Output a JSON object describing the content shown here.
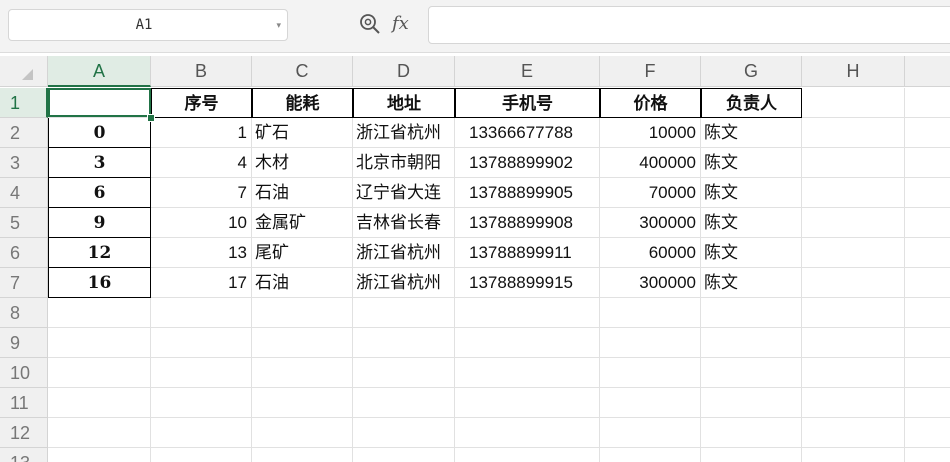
{
  "formula_bar": {
    "name_box_value": "A1",
    "name_box_dropdown": "▾",
    "zoom_icon": "zoom-formula-icon",
    "fx_label": "fx",
    "formula_value": ""
  },
  "columns": [
    "A",
    "B",
    "C",
    "D",
    "E",
    "F",
    "G",
    "H"
  ],
  "active_column": "A",
  "rows": [
    "1",
    "2",
    "3",
    "4",
    "5",
    "6",
    "7",
    "8",
    "9",
    "10",
    "11",
    "12",
    "13"
  ],
  "active_row": "1",
  "header_row": {
    "A": "",
    "B": "序号",
    "C": "能耗",
    "D": "地址",
    "E": "手机号",
    "F": "价格",
    "G": "负责人"
  },
  "data_rows": [
    {
      "A": "0",
      "B": "1",
      "C": "矿石",
      "D": "浙江省杭州",
      "E": "13366677788",
      "F": "10000",
      "G": "陈文"
    },
    {
      "A": "3",
      "B": "4",
      "C": "木材",
      "D": "北京市朝阳",
      "E": "13788899902",
      "F": "400000",
      "G": "陈文"
    },
    {
      "A": "6",
      "B": "7",
      "C": "石油",
      "D": "辽宁省大连",
      "E": "13788899905",
      "F": "70000",
      "G": "陈文"
    },
    {
      "A": "9",
      "B": "10",
      "C": "金属矿",
      "D": "吉林省长春",
      "E": "13788899908",
      "F": "300000",
      "G": "陈文"
    },
    {
      "A": "12",
      "B": "13",
      "C": "尾矿",
      "D": "浙江省杭州",
      "E": "13788899911",
      "F": "60000",
      "G": "陈文"
    },
    {
      "A": "16",
      "B": "17",
      "C": "石油",
      "D": "浙江省杭州",
      "E": "13788899915",
      "F": "300000",
      "G": "陈文"
    }
  ],
  "colors": {
    "accent": "#217346",
    "header_bg": "#f0f0f0",
    "active_header_bg": "#e0ece4"
  }
}
